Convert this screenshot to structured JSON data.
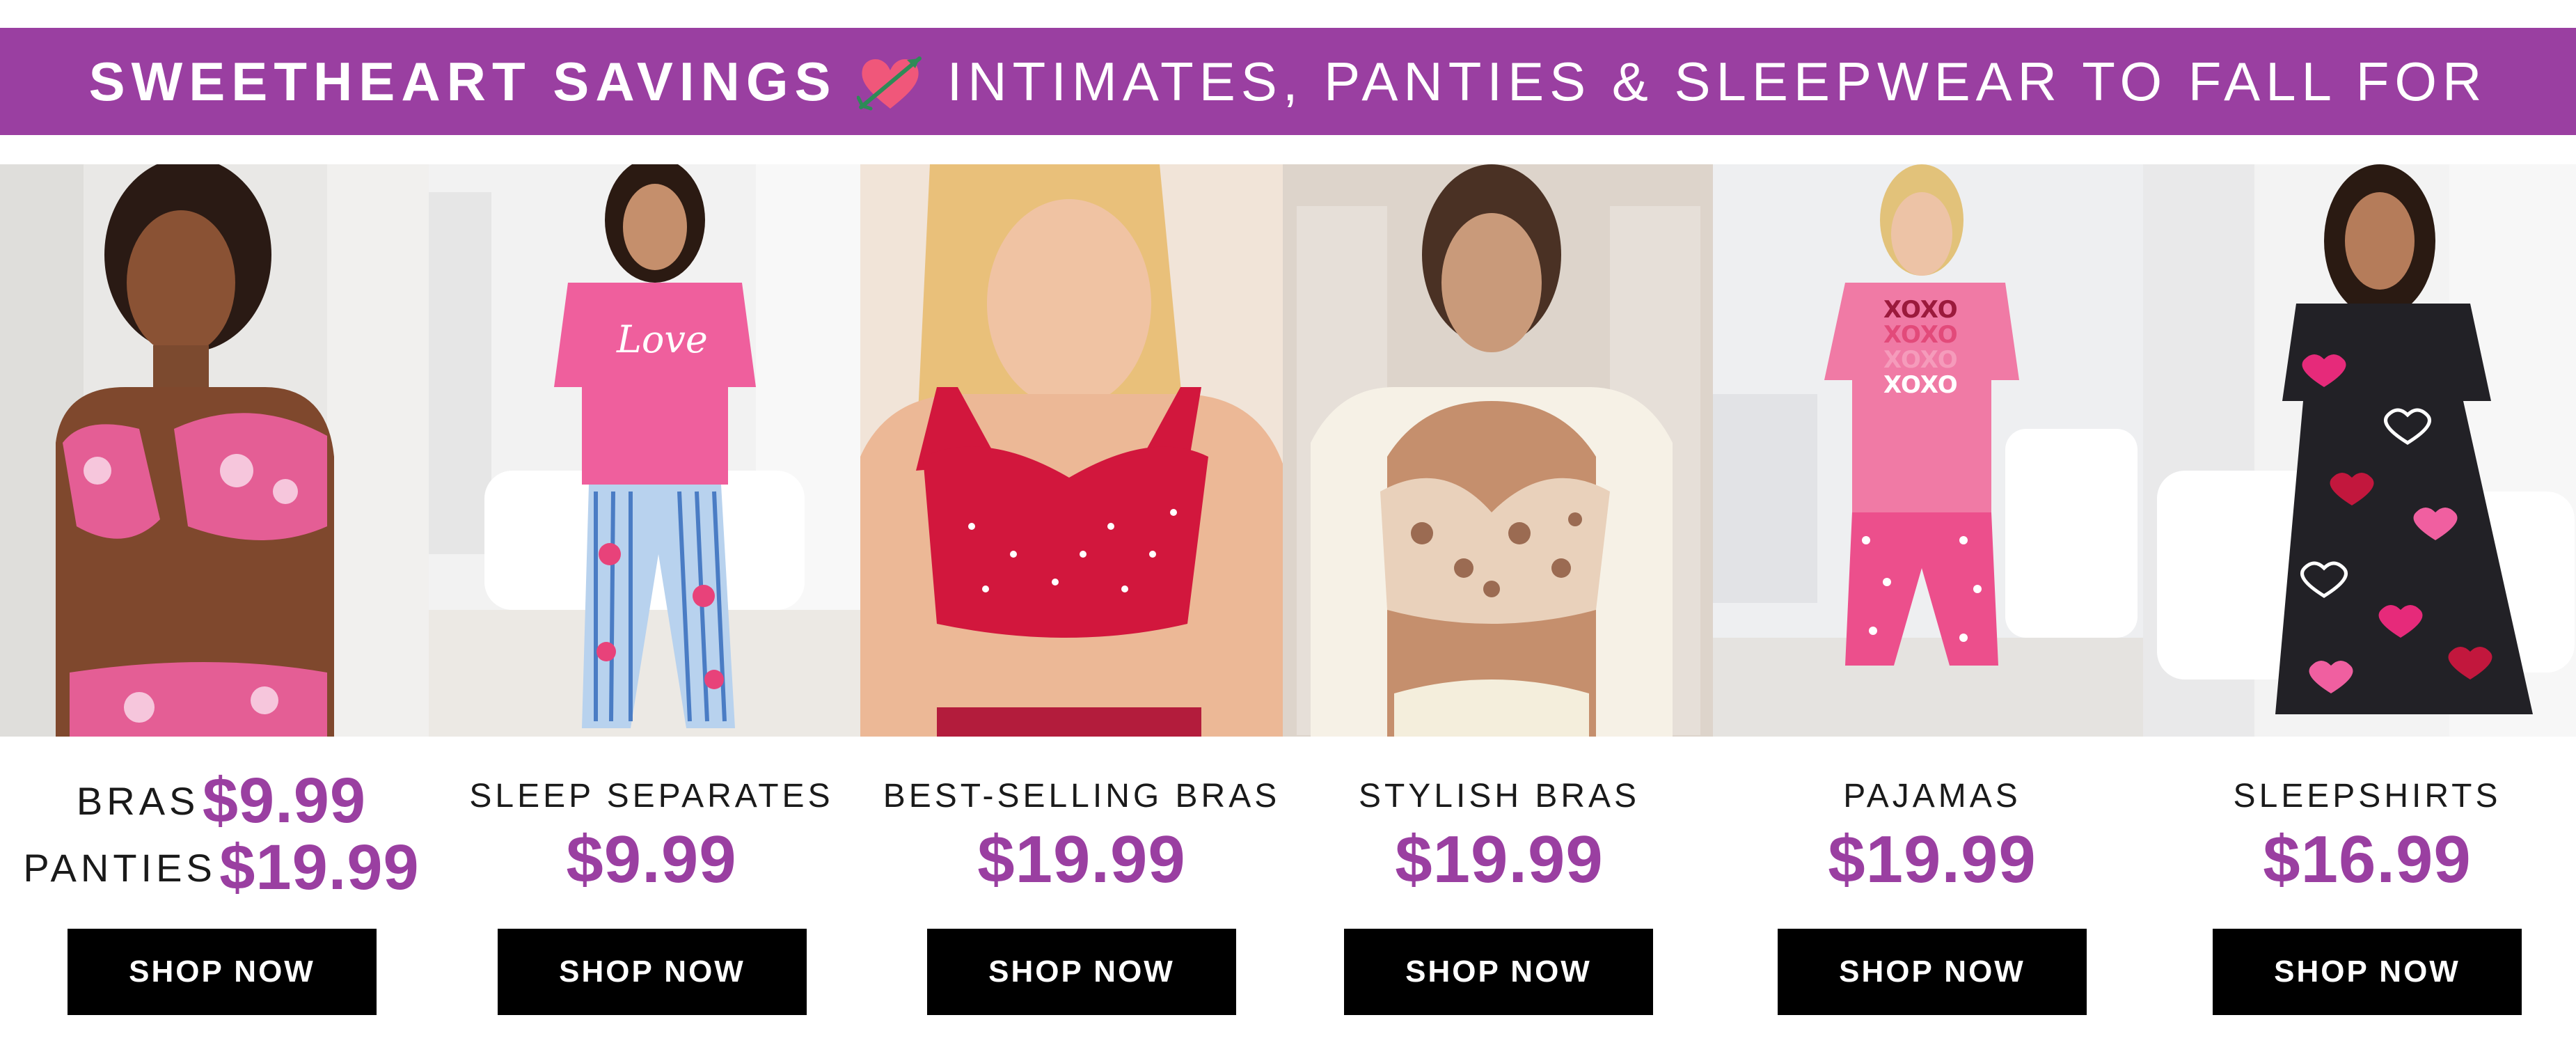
{
  "banner": {
    "headline": "SWEETHEART SAVINGS",
    "tagline": "INTIMATES, PANTIES & SLEEPWEAR TO FALL FOR",
    "background_color": "#9a3fa1",
    "icon": "heart-arrow-icon"
  },
  "products": [
    {
      "image_alt": "Woman in pink floral front-close bra and panties",
      "label_bras": "BRAS",
      "price_bras": "$9.99",
      "label_panties": "PANTIES",
      "price_panties": "$19.99",
      "button": "SHOP NOW"
    },
    {
      "image_alt": "Woman in pink Love tee and striped floral sleep pants",
      "label": "SLEEP SEPARATES",
      "price": "$9.99",
      "button": "SHOP NOW"
    },
    {
      "image_alt": "Woman in red printed wireless bra",
      "label": "BEST-SELLING BRAS",
      "price": "$19.99",
      "button": "SHOP NOW"
    },
    {
      "image_alt": "Woman in beige lace floral bra",
      "label": "STYLISH BRAS",
      "price": "$19.99",
      "button": "SHOP NOW"
    },
    {
      "image_alt": "Woman in pink XOXO tee and capri pajamas",
      "label": "PAJAMAS",
      "price": "$19.99",
      "button": "SHOP NOW"
    },
    {
      "image_alt": "Woman in black heart print sleepshirt",
      "label": "SLEEPSHIRTS",
      "price": "$16.99",
      "button": "SHOP NOW"
    }
  ],
  "colors": {
    "accent": "#9a3fa1",
    "button": "#000000",
    "button_text": "#ffffff"
  }
}
